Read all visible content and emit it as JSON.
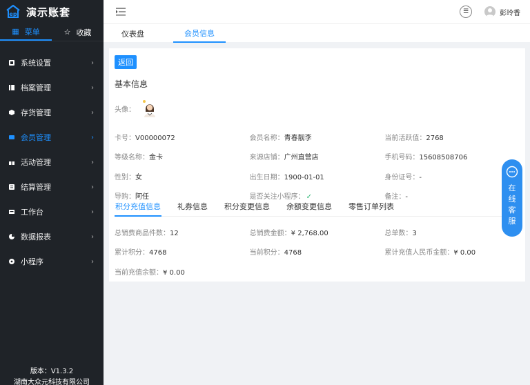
{
  "app": {
    "title": "演示账套"
  },
  "side_tabs": [
    {
      "label": "菜单",
      "icon": "grid-icon"
    },
    {
      "label": "收藏",
      "icon": "star-icon"
    }
  ],
  "menu": [
    {
      "label": "系统设置",
      "icon": "settings-icon"
    },
    {
      "label": "档案管理",
      "icon": "archive-icon"
    },
    {
      "label": "存货管理",
      "icon": "inventory-icon"
    },
    {
      "label": "会员管理",
      "icon": "member-icon"
    },
    {
      "label": "活动管理",
      "icon": "gift-icon"
    },
    {
      "label": "结算管理",
      "icon": "settlement-icon"
    },
    {
      "label": "工作台",
      "icon": "workbench-icon"
    },
    {
      "label": "数据报表",
      "icon": "report-icon"
    },
    {
      "label": "小程序",
      "icon": "miniprogram-icon"
    }
  ],
  "footer": {
    "version": "版本：V1.3.2",
    "company": "湖南大众元科技有限公司"
  },
  "header": {
    "username": "彭玲香"
  },
  "page_tabs": [
    {
      "label": "仪表盘"
    },
    {
      "label": "会员信息"
    }
  ],
  "content": {
    "back": "返回",
    "section_title": "基本信息",
    "avatar_label": "头像：",
    "info": [
      [
        {
          "label": "卡号：",
          "value": "V00000072"
        },
        {
          "label": "会员名称：",
          "value": "青春靓李"
        },
        {
          "label": "当前活跃值：",
          "value": "2768"
        }
      ],
      [
        {
          "label": "等级名称：",
          "value": "金卡"
        },
        {
          "label": "来源店铺：",
          "value": "广州直营店"
        },
        {
          "label": "手机号码：",
          "value": "15608508706"
        }
      ],
      [
        {
          "label": "性别：",
          "value": "女"
        },
        {
          "label": "出生日期：",
          "value": "1900-01-01"
        },
        {
          "label": "身份证号：",
          "value": "-"
        }
      ],
      [
        {
          "label": "导购：",
          "value": "阿任"
        },
        {
          "label": "是否关注小程序：",
          "value": ""
        },
        {
          "label": "备注：",
          "value": "-"
        }
      ]
    ],
    "sub_tabs": [
      "积分充值信息",
      "礼券信息",
      "积分变更信息",
      "余额变更信息",
      "零售订单列表"
    ],
    "stats": [
      [
        {
          "label": "总销费商品件数：",
          "value": "12"
        },
        {
          "label": "总销费金额：",
          "value": "¥ 2,768.00"
        },
        {
          "label": "总单数：",
          "value": "3"
        }
      ],
      [
        {
          "label": "累计积分：",
          "value": "4768"
        },
        {
          "label": "当前积分：",
          "value": "4768"
        },
        {
          "label": "累计充值人民币金额：",
          "value": "¥ 0.00"
        }
      ],
      [
        {
          "label": "当前充值余额：",
          "value": "¥ 0.00"
        }
      ]
    ]
  },
  "online_service": {
    "chars": [
      "在",
      "线",
      "客",
      "服"
    ]
  },
  "colors": {
    "accent": "#1e90ff",
    "sidebar_bg": "#1f2328",
    "check": "#2bb673"
  }
}
